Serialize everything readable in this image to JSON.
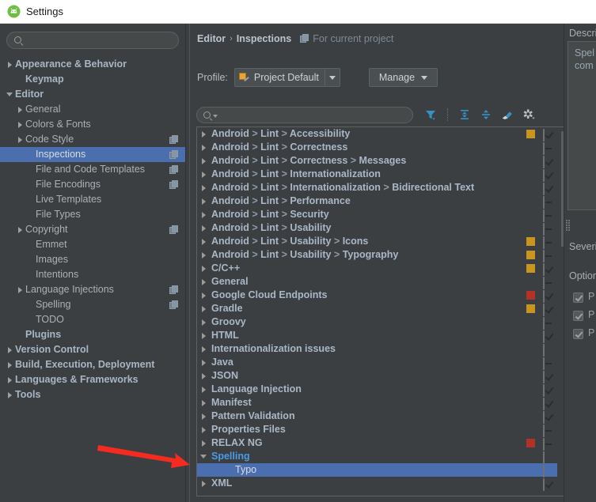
{
  "window": {
    "title": "Settings",
    "icon": "android-studio-icon"
  },
  "sidebar": {
    "search": {
      "value": "",
      "placeholder": ""
    },
    "items": [
      {
        "label": "Appearance & Behavior",
        "twisty": "closed",
        "bold": true,
        "indent": 0,
        "config": false
      },
      {
        "label": "Keymap",
        "twisty": "none",
        "bold": true,
        "indent": 1,
        "config": false
      },
      {
        "label": "Editor",
        "twisty": "open",
        "bold": true,
        "indent": 0,
        "config": false
      },
      {
        "label": "General",
        "twisty": "closed",
        "bold": false,
        "indent": 1,
        "config": false
      },
      {
        "label": "Colors & Fonts",
        "twisty": "closed",
        "bold": false,
        "indent": 1,
        "config": false
      },
      {
        "label": "Code Style",
        "twisty": "closed",
        "bold": false,
        "indent": 1,
        "config": true
      },
      {
        "label": "Inspections",
        "twisty": "none",
        "bold": false,
        "indent": 2,
        "config": true,
        "selected": true
      },
      {
        "label": "File and Code Templates",
        "twisty": "none",
        "bold": false,
        "indent": 2,
        "config": true
      },
      {
        "label": "File Encodings",
        "twisty": "none",
        "bold": false,
        "indent": 2,
        "config": true
      },
      {
        "label": "Live Templates",
        "twisty": "none",
        "bold": false,
        "indent": 2,
        "config": false
      },
      {
        "label": "File Types",
        "twisty": "none",
        "bold": false,
        "indent": 2,
        "config": false
      },
      {
        "label": "Copyright",
        "twisty": "closed",
        "bold": false,
        "indent": 1,
        "config": true
      },
      {
        "label": "Emmet",
        "twisty": "none",
        "bold": false,
        "indent": 2,
        "config": false
      },
      {
        "label": "Images",
        "twisty": "none",
        "bold": false,
        "indent": 2,
        "config": false
      },
      {
        "label": "Intentions",
        "twisty": "none",
        "bold": false,
        "indent": 2,
        "config": false
      },
      {
        "label": "Language Injections",
        "twisty": "closed",
        "bold": false,
        "indent": 1,
        "config": true
      },
      {
        "label": "Spelling",
        "twisty": "none",
        "bold": false,
        "indent": 2,
        "config": true
      },
      {
        "label": "TODO",
        "twisty": "none",
        "bold": false,
        "indent": 2,
        "config": false
      },
      {
        "label": "Plugins",
        "twisty": "none",
        "bold": true,
        "indent": 1,
        "config": false
      },
      {
        "label": "Version Control",
        "twisty": "closed",
        "bold": true,
        "indent": 0,
        "config": false
      },
      {
        "label": "Build, Execution, Deployment",
        "twisty": "closed",
        "bold": true,
        "indent": 0,
        "config": false
      },
      {
        "label": "Languages & Frameworks",
        "twisty": "closed",
        "bold": true,
        "indent": 0,
        "config": false
      },
      {
        "label": "Tools",
        "twisty": "closed",
        "bold": true,
        "indent": 0,
        "config": false
      }
    ]
  },
  "header": {
    "breadcrumb_1": "Editor",
    "breadcrumb_sep": "›",
    "breadcrumb_2": "Inspections",
    "scope_label": "For current project",
    "scope_icon": "copy-icon"
  },
  "profile": {
    "label": "Profile:",
    "value": "Project Default",
    "manage_label": "Manage",
    "dropdown_icon": "chevron-down-icon"
  },
  "filterbar": {
    "search_value": "",
    "search_placeholder": "",
    "icons": [
      {
        "name": "filter-icon"
      },
      {
        "name": "expand-all-icon"
      },
      {
        "name": "collapse-all-icon"
      },
      {
        "name": "reset-icon"
      },
      {
        "name": "settings-gear-icon"
      }
    ]
  },
  "inspections": {
    "rows": [
      {
        "label": "Android > Lint > Accessibility",
        "twisty": "closed",
        "severity": "#c9951e",
        "checkbox": "checked"
      },
      {
        "label": "Android > Lint > Correctness",
        "twisty": "closed",
        "severity": null,
        "checkbox": "indeterminate"
      },
      {
        "label": "Android > Lint > Correctness > Messages",
        "twisty": "closed",
        "severity": null,
        "checkbox": "checked"
      },
      {
        "label": "Android > Lint > Internationalization",
        "twisty": "closed",
        "severity": null,
        "checkbox": "checked"
      },
      {
        "label": "Android > Lint > Internationalization > Bidirectional Text",
        "twisty": "closed",
        "severity": null,
        "checkbox": "checked"
      },
      {
        "label": "Android > Lint > Performance",
        "twisty": "closed",
        "severity": null,
        "checkbox": "indeterminate"
      },
      {
        "label": "Android > Lint > Security",
        "twisty": "closed",
        "severity": null,
        "checkbox": "indeterminate"
      },
      {
        "label": "Android > Lint > Usability",
        "twisty": "closed",
        "severity": null,
        "checkbox": "indeterminate"
      },
      {
        "label": "Android > Lint > Usability > Icons",
        "twisty": "closed",
        "severity": "#c9951e",
        "checkbox": "indeterminate"
      },
      {
        "label": "Android > Lint > Usability > Typography",
        "twisty": "closed",
        "severity": "#c9951e",
        "checkbox": "indeterminate"
      },
      {
        "label": "C/C++",
        "twisty": "closed",
        "severity": "#c9951e",
        "checkbox": "checked"
      },
      {
        "label": "General",
        "twisty": "closed",
        "severity": null,
        "checkbox": "indeterminate"
      },
      {
        "label": "Google Cloud Endpoints",
        "twisty": "closed",
        "severity": "#b33228",
        "checkbox": "checked"
      },
      {
        "label": "Gradle",
        "twisty": "closed",
        "severity": "#c9951e",
        "checkbox": "checked"
      },
      {
        "label": "Groovy",
        "twisty": "closed",
        "severity": null,
        "checkbox": "indeterminate"
      },
      {
        "label": "HTML",
        "twisty": "closed",
        "severity": null,
        "checkbox": "checked"
      },
      {
        "label": "Internationalization issues",
        "twisty": "closed",
        "severity": null,
        "checkbox": "unchecked"
      },
      {
        "label": "Java",
        "twisty": "closed",
        "severity": null,
        "checkbox": "indeterminate"
      },
      {
        "label": "JSON",
        "twisty": "closed",
        "severity": null,
        "checkbox": "checked"
      },
      {
        "label": "Language Injection",
        "twisty": "closed",
        "severity": null,
        "checkbox": "checked"
      },
      {
        "label": "Manifest",
        "twisty": "closed",
        "severity": null,
        "checkbox": "checked"
      },
      {
        "label": "Pattern Validation",
        "twisty": "closed",
        "severity": null,
        "checkbox": "checked"
      },
      {
        "label": "Properties Files",
        "twisty": "closed",
        "severity": null,
        "checkbox": "indeterminate"
      },
      {
        "label": "RELAX NG",
        "twisty": "closed",
        "severity": "#b33228",
        "checkbox": "indeterminate"
      },
      {
        "label": "Spelling",
        "twisty": "open",
        "severity": null,
        "checkbox": "unchecked",
        "expanded": true
      },
      {
        "label": "Typo",
        "twisty": "none",
        "severity": null,
        "checkbox": "unchecked",
        "leaf": true,
        "selected": true
      },
      {
        "label": "XML",
        "twisty": "closed",
        "severity": null,
        "checkbox": "checked"
      }
    ]
  },
  "details": {
    "description_label": "Description",
    "description_line_1": "Spel",
    "description_line_2": "com",
    "severity_label": "Severity",
    "options_label": "Options",
    "option_1": "P",
    "option_2": "P",
    "option_3": "P"
  },
  "annotation": {
    "arrow_color": "#f62b1f"
  },
  "colors": {
    "selection": "#4b6eaf",
    "background": "#3c3f41",
    "text": "#a9b7c6",
    "warning": "#c9951e",
    "error": "#b33228"
  }
}
